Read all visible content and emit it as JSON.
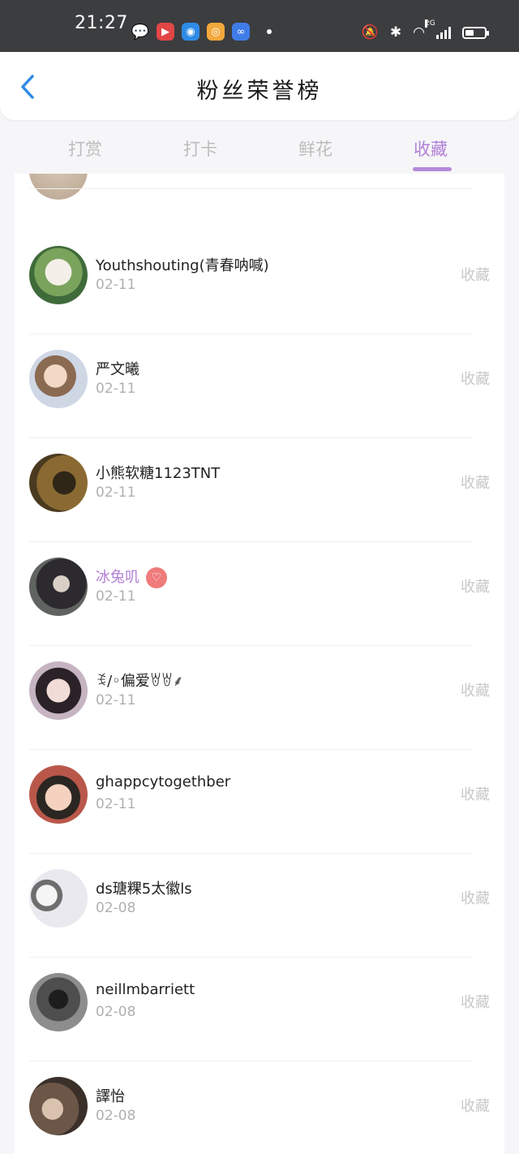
{
  "status_bar": {
    "time": "21:27",
    "network": "2G",
    "battery_level": 0.45,
    "app_icons": [
      "wechat-icon",
      "video-app-icon",
      "browser-icon",
      "weibo-icon",
      "cloud-app-icon"
    ]
  },
  "header": {
    "back_icon": "chevron-left-icon",
    "title": "粉丝荣誉榜"
  },
  "tabs": [
    {
      "label": "打赏",
      "active": false
    },
    {
      "label": "打卡",
      "active": false
    },
    {
      "label": "鲜花",
      "active": false
    },
    {
      "label": "收藏",
      "active": true
    }
  ],
  "colors": {
    "accent": "#b07fd6",
    "badge": "#ef7b7b",
    "muted": "#b0b0b0"
  },
  "fans": [
    {
      "name": "Youthshouting(青春呐喊)",
      "date": "02-11",
      "action": "收藏"
    },
    {
      "name": "严文曦",
      "date": "02-11",
      "action": "收藏"
    },
    {
      "name": "小熊软糖1123TNT",
      "date": "02-11",
      "action": "收藏"
    },
    {
      "name": "冰兔叽",
      "date": "02-11",
      "action": "收藏",
      "badge": "heart-diamond-icon"
    },
    {
      "name": "ꉂ/◦偏爱ꇐꇐ⸙",
      "date": "02-11",
      "action": "收藏"
    },
    {
      "name": "ghappcytogethber",
      "date": "02-11",
      "action": "收藏"
    },
    {
      "name": "ds瑭粿5太徽ls",
      "date": "02-08",
      "action": "收藏"
    },
    {
      "name": "neillmbarriett",
      "date": "02-08",
      "action": "收藏"
    },
    {
      "name": "譯怡",
      "date": "02-08",
      "action": "收藏"
    }
  ]
}
